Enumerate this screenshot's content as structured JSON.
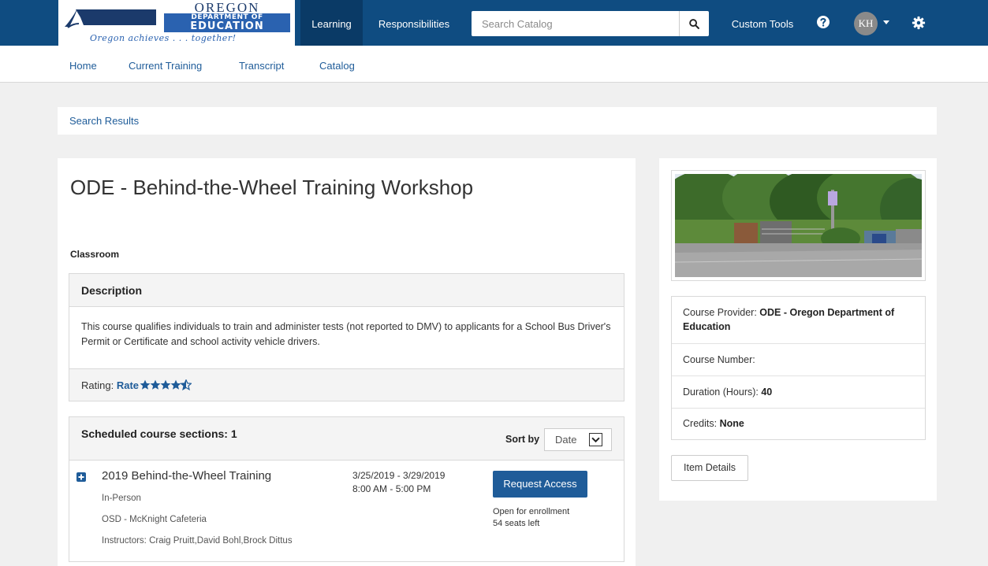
{
  "logo": {
    "oregon": "OREGON",
    "department": "DEPARTMENT OF",
    "education": "EDUCATION",
    "tagline": "Oregon achieves . . . together!"
  },
  "topnav": {
    "learning": "Learning",
    "responsibilities": "Responsibilities",
    "search_placeholder": "Search Catalog",
    "custom_tools": "Custom Tools",
    "avatar_initials": "KH",
    "brand_color": "#0f4c81"
  },
  "subnav": {
    "home": "Home",
    "current_training": "Current Training",
    "transcript": "Transcript",
    "catalog": "Catalog"
  },
  "breadcrumb": {
    "search_results": "Search Results"
  },
  "course": {
    "title": "ODE - Behind-the-Wheel Training Workshop",
    "type": "Classroom",
    "description_heading": "Description",
    "description": "This  course qualifies individuals to train and administer tests (not reported to DMV) to applicants for a School Bus Driver's Permit or Certificate and school activity vehicle drivers.",
    "rating_label": "Rating:",
    "rating_link": "Rate",
    "rating_stars": 4.5
  },
  "sections": {
    "heading": "Scheduled course sections: 1",
    "sort_label": "Sort by",
    "sort_value": "Date",
    "items": [
      {
        "name": "2019 Behind-the-Wheel Training",
        "mode": "In-Person",
        "location": "OSD - McKnight Cafeteria",
        "instructors": "Instructors: Craig Pruitt,David Bohl,Brock Dittus",
        "dates": "3/25/2019 - 3/29/2019",
        "times": "8:00 AM - 5:00 PM",
        "action": "Request Access",
        "status": "Open for enrollment",
        "seats": "54 seats left"
      }
    ]
  },
  "sidebar": {
    "provider_label": "Course Provider:",
    "provider_value": "ODE - Oregon Department of Education",
    "number_label": "Course Number:",
    "duration_label": "Duration (Hours):",
    "duration_value": "40",
    "credits_label": "Credits:",
    "credits_value": "None",
    "item_details": "Item Details"
  }
}
